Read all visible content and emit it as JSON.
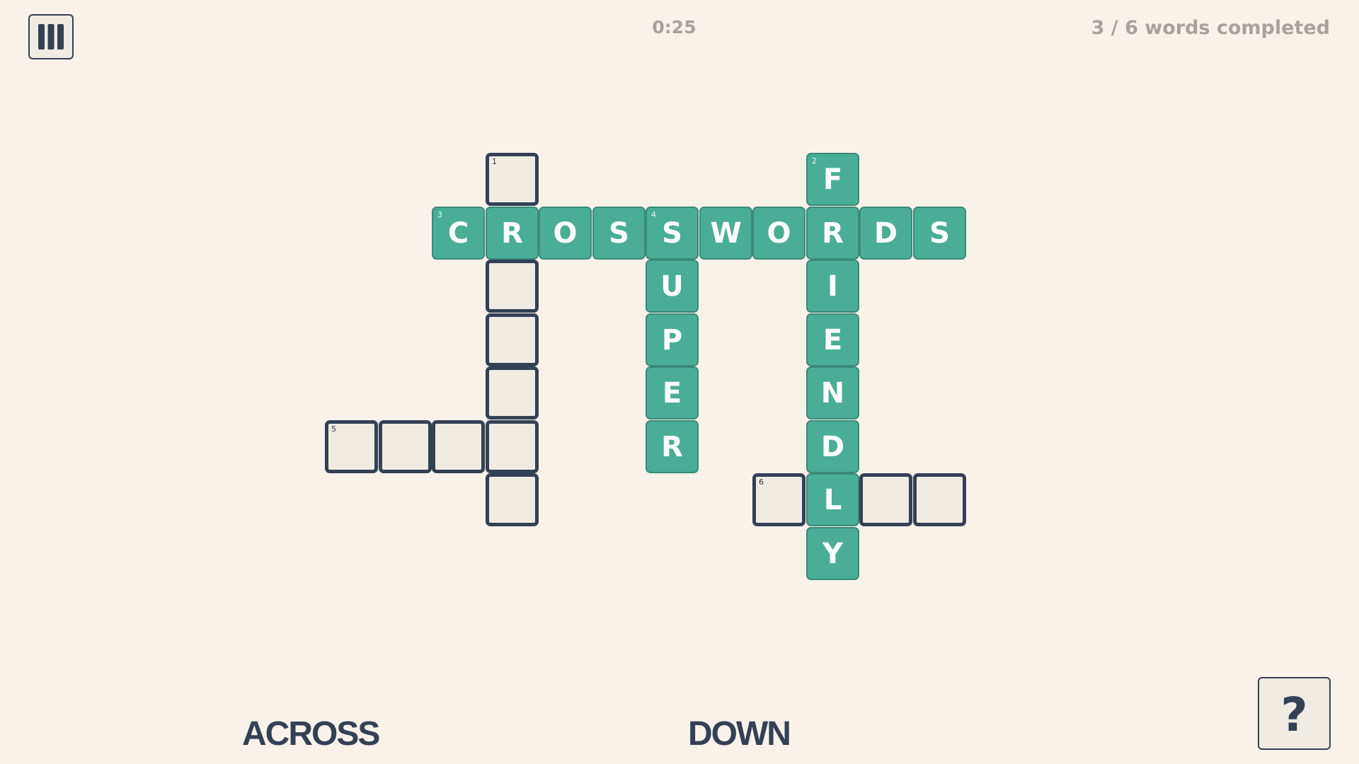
{
  "header": {
    "menu_icon": "menu-bars-icon",
    "timer": "0:25",
    "progress": "3 / 6 words completed"
  },
  "clues": {
    "across_heading": "ACROSS",
    "down_heading": "DOWN"
  },
  "help": {
    "icon": "help-icon",
    "glyph": "?"
  },
  "colors": {
    "background": "#f8f2eb",
    "filled_cell": "#4aae96",
    "empty_cell": "#f0ebe3",
    "outline": "#344054",
    "muted_text": "#a7a39c"
  },
  "puzzle": {
    "rows": 9,
    "cols": 12,
    "cells": [
      {
        "r": 0,
        "c": 3,
        "num": "1",
        "letter": "",
        "filled": false
      },
      {
        "r": 0,
        "c": 9,
        "num": "2",
        "letter": "F",
        "filled": true
      },
      {
        "r": 1,
        "c": 2,
        "num": "3",
        "letter": "C",
        "filled": true
      },
      {
        "r": 1,
        "c": 3,
        "num": "",
        "letter": "R",
        "filled": true
      },
      {
        "r": 1,
        "c": 4,
        "num": "",
        "letter": "O",
        "filled": true
      },
      {
        "r": 1,
        "c": 5,
        "num": "",
        "letter": "S",
        "filled": true
      },
      {
        "r": 1,
        "c": 6,
        "num": "4",
        "letter": "S",
        "filled": true
      },
      {
        "r": 1,
        "c": 7,
        "num": "",
        "letter": "W",
        "filled": true
      },
      {
        "r": 1,
        "c": 8,
        "num": "",
        "letter": "O",
        "filled": true
      },
      {
        "r": 1,
        "c": 9,
        "num": "",
        "letter": "R",
        "filled": true
      },
      {
        "r": 1,
        "c": 10,
        "num": "",
        "letter": "D",
        "filled": true
      },
      {
        "r": 1,
        "c": 11,
        "num": "",
        "letter": "S",
        "filled": true
      },
      {
        "r": 2,
        "c": 3,
        "num": "",
        "letter": "",
        "filled": false
      },
      {
        "r": 2,
        "c": 6,
        "num": "",
        "letter": "U",
        "filled": true
      },
      {
        "r": 2,
        "c": 9,
        "num": "",
        "letter": "I",
        "filled": true
      },
      {
        "r": 3,
        "c": 3,
        "num": "",
        "letter": "",
        "filled": false
      },
      {
        "r": 3,
        "c": 6,
        "num": "",
        "letter": "P",
        "filled": true
      },
      {
        "r": 3,
        "c": 9,
        "num": "",
        "letter": "E",
        "filled": true
      },
      {
        "r": 4,
        "c": 3,
        "num": "",
        "letter": "",
        "filled": false
      },
      {
        "r": 4,
        "c": 6,
        "num": "",
        "letter": "E",
        "filled": true
      },
      {
        "r": 4,
        "c": 9,
        "num": "",
        "letter": "N",
        "filled": true
      },
      {
        "r": 5,
        "c": 0,
        "num": "5",
        "letter": "",
        "filled": false
      },
      {
        "r": 5,
        "c": 1,
        "num": "",
        "letter": "",
        "filled": false
      },
      {
        "r": 5,
        "c": 2,
        "num": "",
        "letter": "",
        "filled": false
      },
      {
        "r": 5,
        "c": 3,
        "num": "",
        "letter": "",
        "filled": false
      },
      {
        "r": 5,
        "c": 6,
        "num": "",
        "letter": "R",
        "filled": true
      },
      {
        "r": 5,
        "c": 9,
        "num": "",
        "letter": "D",
        "filled": true
      },
      {
        "r": 6,
        "c": 3,
        "num": "",
        "letter": "",
        "filled": false
      },
      {
        "r": 6,
        "c": 8,
        "num": "6",
        "letter": "",
        "filled": false
      },
      {
        "r": 6,
        "c": 9,
        "num": "",
        "letter": "L",
        "filled": true
      },
      {
        "r": 6,
        "c": 10,
        "num": "",
        "letter": "",
        "filled": false
      },
      {
        "r": 6,
        "c": 11,
        "num": "",
        "letter": "",
        "filled": false
      },
      {
        "r": 7,
        "c": 9,
        "num": "",
        "letter": "Y",
        "filled": true
      }
    ]
  }
}
